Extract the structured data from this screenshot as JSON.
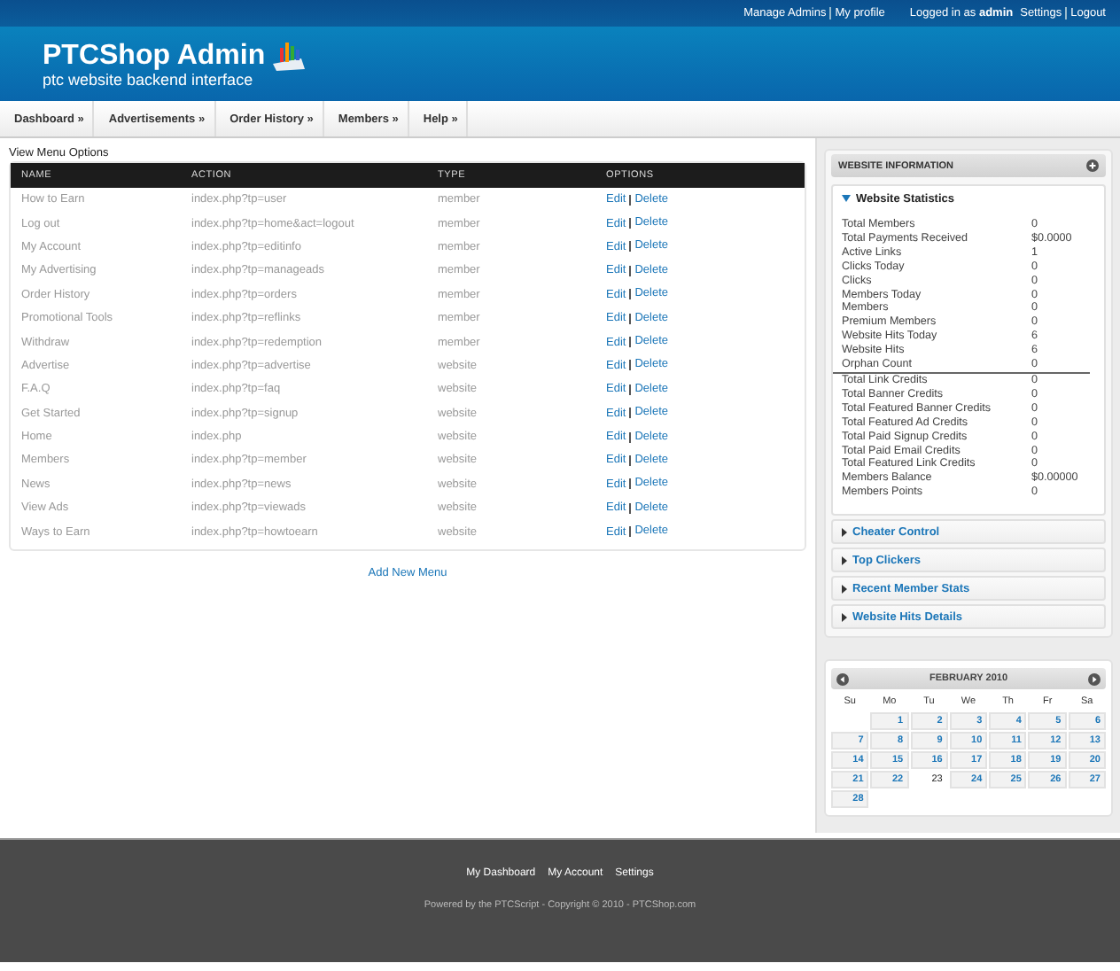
{
  "top_bar": {
    "links_left": [
      "Manage Admins",
      "My profile"
    ],
    "logged_in": "Logged in as **admin**",
    "links_right": [
      "Settings",
      "Logout"
    ]
  },
  "header": {
    "title": "PTCShop Admin",
    "subtitle": "ptc website backend interface"
  },
  "nav": [
    "Dashboard »",
    "Advertisements »",
    "Order History »",
    "Members »",
    "Help »"
  ],
  "menu_table": {
    "title": "View Menu Options",
    "columns": [
      "NAME",
      "ACTION",
      "TYPE",
      "OPTIONS"
    ],
    "rows": [
      {
        "name": "How to Earn",
        "action": "index.php?tp=user",
        "type": "member",
        "edit": "Edit",
        "delete": "Delete"
      },
      {
        "name": "Log out",
        "action": "index.php?tp=home&act=logout",
        "type": "member",
        "edit": "Edit",
        "delete": "Delete"
      },
      {
        "name": "My Account",
        "action": "index.php?tp=editinfo",
        "type": "member",
        "edit": "Edit",
        "delete": "Delete"
      },
      {
        "name": "My Advertising",
        "action": "index.php?tp=manageads",
        "type": "member",
        "edit": "Edit",
        "delete": "Delete"
      },
      {
        "name": "Order History",
        "action": "index.php?tp=orders",
        "type": "member",
        "edit": "Edit",
        "delete": "Delete"
      },
      {
        "name": "Promotional Tools",
        "action": "index.php?tp=reflinks",
        "type": "member",
        "edit": "Edit",
        "delete": "Delete"
      },
      {
        "name": "Withdraw",
        "action": "index.php?tp=redemption",
        "type": "member",
        "edit": "Edit",
        "delete": "Delete"
      },
      {
        "name": "Advertise",
        "action": "index.php?tp=advertise",
        "type": "website",
        "edit": "Edit",
        "delete": "Delete"
      },
      {
        "name": "F.A.Q",
        "action": "index.php?tp=faq",
        "type": "website",
        "edit": "Edit",
        "delete": "Delete"
      },
      {
        "name": "Get Started",
        "action": "index.php?tp=signup",
        "type": "website",
        "edit": "Edit",
        "delete": "Delete"
      },
      {
        "name": "Home",
        "action": "index.php",
        "type": "website",
        "edit": "Edit",
        "delete": "Delete"
      },
      {
        "name": "Members",
        "action": "index.php?tp=member",
        "type": "website",
        "edit": "Edit",
        "delete": "Delete"
      },
      {
        "name": "News",
        "action": "index.php?tp=news",
        "type": "website",
        "edit": "Edit",
        "delete": "Delete"
      },
      {
        "name": "View Ads",
        "action": "index.php?tp=viewads",
        "type": "website",
        "edit": "Edit",
        "delete": "Delete"
      },
      {
        "name": "Ways to Earn",
        "action": "index.php?tp=howtoearn",
        "type": "website",
        "edit": "Edit",
        "delete": "Delete"
      }
    ],
    "add_link": "Add New Menu"
  },
  "website_information": {
    "title": "WEBSITE INFORMATION",
    "sections": [
      {
        "title": "Website Statistics",
        "expanded": true,
        "stat_groups": [
          [
            {
              "label": "Total Members",
              "value": "0"
            },
            {
              "label": "Total Payments Received",
              "value": "$0.0000"
            },
            {
              "label": "Active Links",
              "value": "1"
            },
            {
              "label": "Clicks Today",
              "value": "0"
            },
            {
              "label": "Clicks",
              "value": "0"
            },
            {
              "label": "Members Today",
              "value": "0"
            },
            {
              "label": "Members",
              "value": "0"
            },
            {
              "label": "Premium Members",
              "value": "0"
            },
            {
              "label": "Website Hits Today",
              "value": "6"
            },
            {
              "label": "Website Hits",
              "value": "6"
            },
            {
              "label": "Orphan Count",
              "value": "0"
            }
          ],
          [
            {
              "label": "Total Link Credits",
              "value": "0"
            },
            {
              "label": "Total Banner Credits",
              "value": "0"
            },
            {
              "label": "Total Featured Banner Credits",
              "value": "0"
            },
            {
              "label": "Total Featured Ad Credits",
              "value": "0"
            },
            {
              "label": "Total Paid Signup Credits",
              "value": "0"
            },
            {
              "label": "Total Paid Email Credits",
              "value": "0"
            },
            {
              "label": "Total Featured Link Credits",
              "value": "0"
            },
            {
              "label": "Members Balance",
              "value": "$0.00000"
            },
            {
              "label": "Members Points",
              "value": "0"
            }
          ]
        ]
      },
      {
        "title": "Cheater Control",
        "expanded": false
      },
      {
        "title": "Top Clickers",
        "expanded": false
      },
      {
        "title": "Recent Member Stats",
        "expanded": false
      },
      {
        "title": "Website Hits Details",
        "expanded": false
      }
    ]
  },
  "calendar": {
    "month": "FEBRUARY 2010",
    "weekdays": [
      "Su",
      "Mo",
      "Tu",
      "We",
      "Th",
      "Fr",
      "Sa"
    ],
    "weeks": [
      [
        {
          "day": "1",
          "selected": false
        },
        {
          "day": "2",
          "selected": false
        },
        {
          "day": "3",
          "selected": false
        },
        {
          "day": "4",
          "selected": false
        },
        {
          "day": "5",
          "selected": false
        },
        {
          "day": "6",
          "selected": false
        }
      ],
      [
        {
          "day": "7",
          "selected": false
        },
        {
          "day": "8",
          "selected": false
        },
        {
          "day": "9",
          "selected": false
        },
        {
          "day": "10",
          "selected": false
        },
        {
          "day": "11",
          "selected": false
        },
        {
          "day": "12",
          "selected": false
        },
        {
          "day": "13",
          "selected": false
        }
      ],
      [
        {
          "day": "14",
          "selected": false
        },
        {
          "day": "15",
          "selected": false
        },
        {
          "day": "16",
          "selected": false
        },
        {
          "day": "17",
          "selected": false
        },
        {
          "day": "18",
          "selected": false
        },
        {
          "day": "19",
          "selected": false
        },
        {
          "day": "20",
          "selected": false
        }
      ],
      [
        {
          "day": "21",
          "selected": false
        },
        {
          "day": "22",
          "selected": false
        },
        {
          "day": "23",
          "selected": true
        },
        {
          "day": "24",
          "selected": false
        },
        {
          "day": "25",
          "selected": false
        },
        {
          "day": "26",
          "selected": false
        },
        {
          "day": "27",
          "selected": false
        }
      ],
      [
        {
          "day": "28",
          "selected": false
        }
      ]
    ]
  },
  "footer": {
    "links": [
      "My Dashboard",
      "My Account",
      "Settings"
    ],
    "copyright": "Powered by the PTCScript - Copyright © 2010 - PTCShop.com"
  }
}
